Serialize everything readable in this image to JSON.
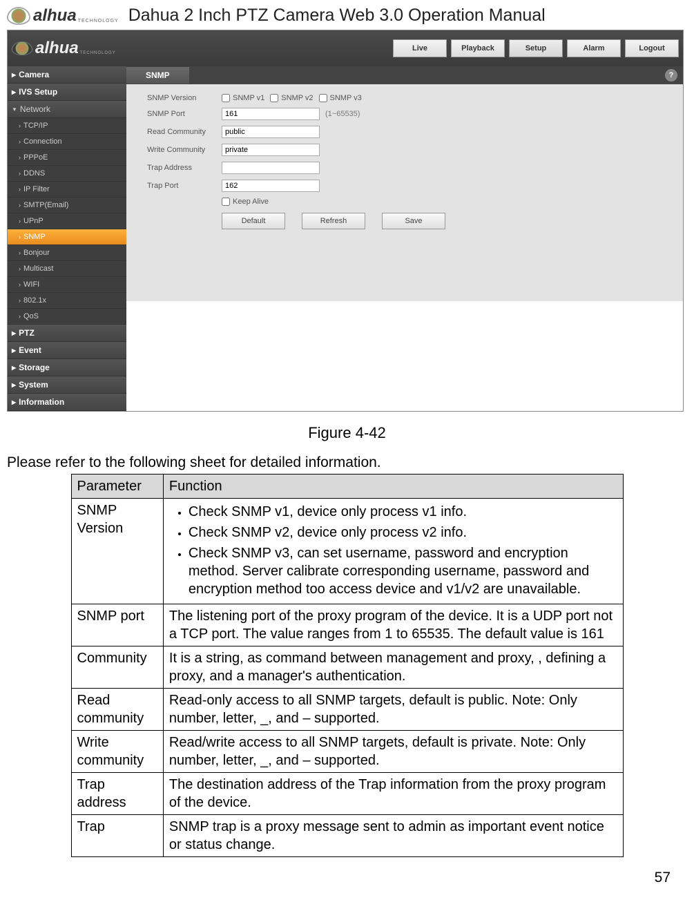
{
  "doc": {
    "title": "Dahua 2 Inch PTZ Camera Web 3.0 Operation Manual",
    "brand": "alhua",
    "brand_sub": "TECHNOLOGY"
  },
  "tabs": {
    "live": "Live",
    "playback": "Playback",
    "setup": "Setup",
    "alarm": "Alarm",
    "logout": "Logout"
  },
  "sidebar": {
    "camera": "Camera",
    "ivs": "IVS Setup",
    "network": "Network",
    "items": [
      "TCP/IP",
      "Connection",
      "PPPoE",
      "DDNS",
      "IP Filter",
      "SMTP(Email)",
      "UPnP",
      "SNMP",
      "Bonjour",
      "Multicast",
      "WIFI",
      "802.1x",
      "QoS"
    ],
    "ptz": "PTZ",
    "event": "Event",
    "storage": "Storage",
    "system": "System",
    "information": "Information"
  },
  "panel": {
    "title": "SNMP",
    "help": "?",
    "rows": {
      "version_label": "SNMP Version",
      "v1": "SNMP v1",
      "v2": "SNMP v2",
      "v3": "SNMP v3",
      "port_label": "SNMP Port",
      "port_value": "161",
      "port_hint": "(1~65535)",
      "read_label": "Read Community",
      "read_value": "public",
      "write_label": "Write Community",
      "write_value": "private",
      "trap_addr_label": "Trap Address",
      "trap_addr_value": "",
      "trap_port_label": "Trap Port",
      "trap_port_value": "162",
      "keep_alive": "Keep Alive"
    },
    "buttons": {
      "default": "Default",
      "refresh": "Refresh",
      "save": "Save"
    }
  },
  "figure": "Figure 4-42",
  "intro": "Please refer to the following sheet for detailed information.",
  "table": {
    "h1": "Parameter",
    "h2": "Function",
    "r1p": "SNMP Version",
    "r1b1": "Check SNMP v1, device only process v1 info.",
    "r1b2": "Check SNMP v2, device only process v2 info.",
    "r1b3": "Check SNMP v3, can set username, password and encryption method. Server calibrate corresponding username, password and encryption method too access device and v1/v2 are unavailable.",
    "r2p": "SNMP port",
    "r2f": "The listening port of the proxy program of the device. It is a UDP port not a TCP port. The value ranges from 1 to 65535. The default value is 161",
    "r3p": "Community",
    "r3f": "It is a string, as command between management and proxy, , defining a proxy,  and a manager's authentication.",
    "r4p": "Read community",
    "r4f": "Read-only access to all SNMP targets, default is public. Note: Only number, letter, _, and – supported.",
    "r5p": "Write community",
    "r5f": "Read/write access to all SNMP targets, default is private. Note: Only number, letter, _, and – supported.",
    "r6p": "Trap address",
    "r6f": "The destination address of the Trap information from the proxy program of the device.",
    "r7p": "Trap",
    "r7f": "SNMP trap is a proxy message sent to admin as important event notice or status change."
  },
  "page_number": "57"
}
